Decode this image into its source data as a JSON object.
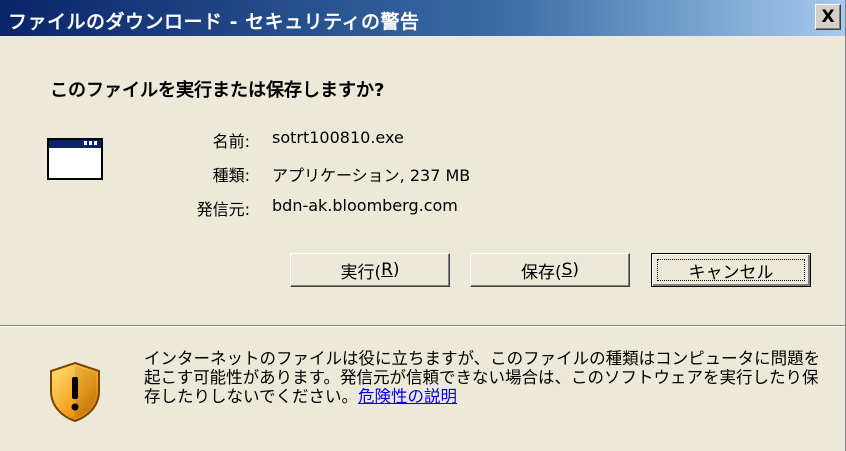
{
  "window": {
    "title": "ファイルのダウンロード - セキュリティの警告",
    "close_label": "X"
  },
  "dialog": {
    "question": "このファイルを実行または保存しますか?",
    "file_icon": "application-window-icon",
    "info": [
      {
        "label": "名前:",
        "value": "sotrt100810.exe"
      },
      {
        "label": "種類:",
        "value": "アプリケーション, 237 MB"
      },
      {
        "label": "発信元:",
        "value": "bdn-ak.bloomberg.com"
      }
    ],
    "buttons": {
      "run": {
        "text": "実行(",
        "accel": "R",
        "close": ")"
      },
      "save": {
        "text": "保存(",
        "accel": "S",
        "close": ")"
      },
      "cancel": {
        "text": "キャンセル"
      }
    }
  },
  "warning": {
    "icon": "security-shield-warning-icon",
    "text": "インターネットのファイルは役に立ちますが、このファイルの種類はコンピュータに問題を起こす可能性があります。発信元が信頼できない場合は、このソフトウェアを実行したり保存したりしないでください。",
    "link_label": "危険性の説明"
  }
}
